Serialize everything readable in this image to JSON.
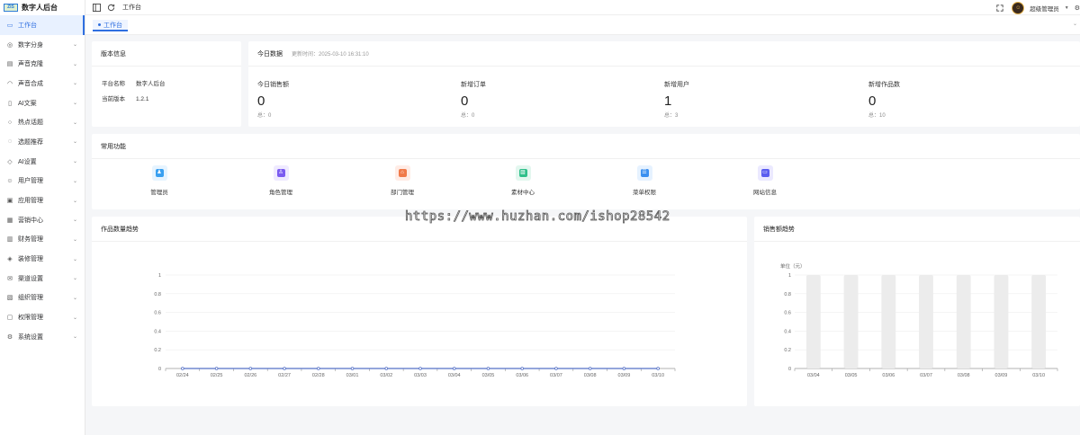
{
  "app": {
    "title": "数字人后台",
    "logo_text": "ZIS"
  },
  "sidebar": {
    "items": [
      {
        "label": "工作台",
        "icon": "monitor-icon",
        "active": true,
        "chevron": false
      },
      {
        "label": "数字分身",
        "icon": "bot-icon",
        "chevron": true
      },
      {
        "label": "声音克隆",
        "icon": "sound-icon",
        "chevron": true
      },
      {
        "label": "声音合成",
        "icon": "headphones-icon",
        "chevron": true
      },
      {
        "label": "AI文案",
        "icon": "book-icon",
        "chevron": true
      },
      {
        "label": "热点话题",
        "icon": "search-icon",
        "chevron": true
      },
      {
        "label": "选题推荐",
        "icon": "bulb-icon",
        "chevron": true
      },
      {
        "label": "AI设置",
        "icon": "shield-icon",
        "chevron": true
      },
      {
        "label": "用户管理",
        "icon": "user-icon",
        "chevron": true
      },
      {
        "label": "应用管理",
        "icon": "app-icon",
        "chevron": true
      },
      {
        "label": "营销中心",
        "icon": "gift-icon",
        "chevron": true
      },
      {
        "label": "财务管理",
        "icon": "finance-icon",
        "chevron": true
      },
      {
        "label": "装修管理",
        "icon": "brush-icon",
        "chevron": true
      },
      {
        "label": "渠道设置",
        "icon": "mail-icon",
        "chevron": true
      },
      {
        "label": "组织管理",
        "icon": "org-icon",
        "chevron": true
      },
      {
        "label": "权限管理",
        "icon": "lock-icon",
        "chevron": true
      },
      {
        "label": "系统设置",
        "icon": "gear-icon",
        "chevron": true
      }
    ]
  },
  "topbar": {
    "breadcrumb": "工作台",
    "user_name": "超级管理员"
  },
  "tabs": [
    {
      "label": "工作台"
    }
  ],
  "version_card": {
    "title": "版本信息",
    "rows": [
      {
        "key": "平台名称",
        "value": "数字人后台"
      },
      {
        "key": "当前版本",
        "value": "1.2.1"
      }
    ]
  },
  "today_card": {
    "title": "今日数据",
    "updated": "更新时间：2025-03-10 16:31:10",
    "stats": [
      {
        "label": "今日销售额",
        "value": "0",
        "total": "总：0"
      },
      {
        "label": "新增订单",
        "value": "0",
        "total": "总：0"
      },
      {
        "label": "新增用户",
        "value": "1",
        "total": "总：3"
      },
      {
        "label": "新增作品数",
        "value": "0",
        "total": "总：10"
      }
    ]
  },
  "functions_card": {
    "title": "常用功能",
    "items": [
      {
        "label": "管理员",
        "icon": "admin-icon",
        "bg": "#e6f4ff",
        "fg": "#3aa0f0"
      },
      {
        "label": "角色管理",
        "icon": "role-icon",
        "bg": "#efeaff",
        "fg": "#7b5cf0"
      },
      {
        "label": "部门管理",
        "icon": "department-icon",
        "bg": "#ffece6",
        "fg": "#f07a4a"
      },
      {
        "label": "素材中心",
        "icon": "material-icon",
        "bg": "#e3f7ef",
        "fg": "#2fbf8a"
      },
      {
        "label": "菜单权限",
        "icon": "menu-permission-icon",
        "bg": "#e6f2ff",
        "fg": "#3a8ff0"
      },
      {
        "label": "网站信息",
        "icon": "website-icon",
        "bg": "#ebe9ff",
        "fg": "#5a5cf0"
      }
    ]
  },
  "watermark": "https://www.huzhan.com/ishop28542",
  "chart_data": [
    {
      "type": "line",
      "title": "作品数量趋势",
      "x": [
        "02/24",
        "02/25",
        "02/26",
        "02/27",
        "02/28",
        "03/01",
        "03/02",
        "03/03",
        "03/04",
        "03/05",
        "03/06",
        "03/07",
        "03/08",
        "03/09",
        "03/10"
      ],
      "series": [
        {
          "values": [
            0,
            0,
            0,
            0,
            0,
            0,
            0,
            0,
            0,
            0,
            0,
            0,
            0,
            0,
            0
          ],
          "color": "#5470c6"
        }
      ],
      "yticks": [
        "0",
        "0.2",
        "0.4",
        "0.6",
        "0.8",
        "1"
      ],
      "ylim": [
        0,
        1
      ],
      "grid": true
    },
    {
      "type": "bar",
      "title": "销售额趋势",
      "ylabel": "单位（元）",
      "categories": [
        "03/04",
        "03/05",
        "03/06",
        "03/07",
        "03/08",
        "03/09",
        "03/10"
      ],
      "values": [
        0,
        0,
        0,
        0,
        0,
        0,
        0
      ],
      "yticks": [
        "0",
        "0.2",
        "0.4",
        "0.6",
        "0.8",
        "1"
      ],
      "ylim": [
        0,
        1
      ],
      "background_bar_color": "#ececec",
      "grid": true
    }
  ]
}
